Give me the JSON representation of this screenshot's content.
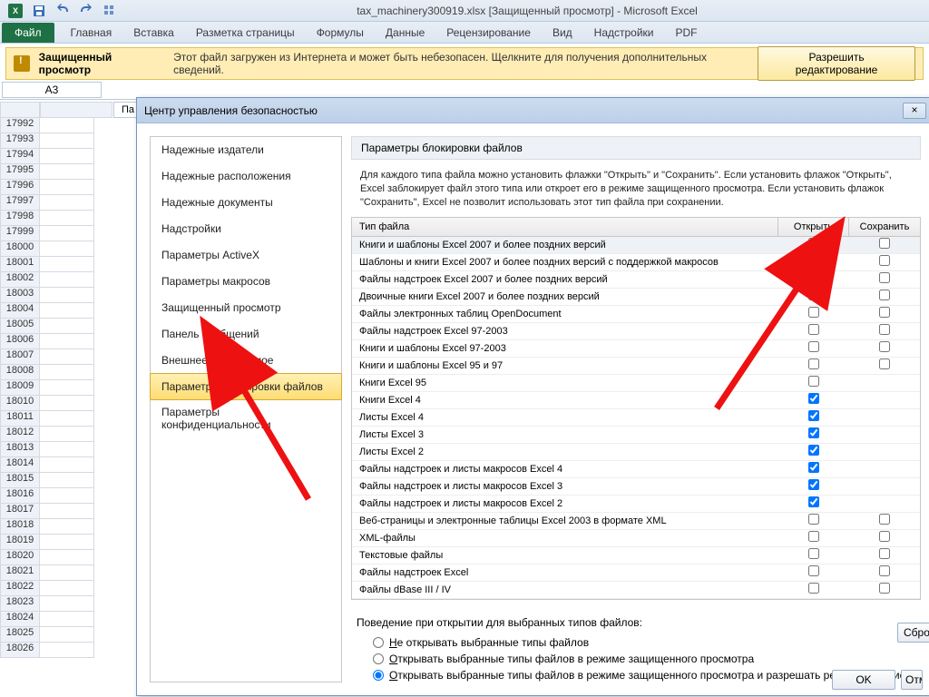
{
  "titlebar": {
    "title": "tax_machinery300919.xlsx  [Защищенный просмотр]  -  Microsoft Excel"
  },
  "ribbon": {
    "file": "Файл",
    "tabs": [
      "Главная",
      "Вставка",
      "Разметка страницы",
      "Формулы",
      "Данные",
      "Рецензирование",
      "Вид",
      "Надстройки",
      "PDF"
    ]
  },
  "protected_view": {
    "label": "Защищенный просмотр",
    "text": "Этот файл загружен из Интернета и может быть небезопасен. Щелкните для получения дополнительных сведений.",
    "button": "Разрешить редактирование"
  },
  "namebox": "A3",
  "partial_header": "Па",
  "row_numbers": [
    17992,
    17993,
    17994,
    17995,
    17996,
    17997,
    17998,
    17999,
    18000,
    18001,
    18002,
    18003,
    18004,
    18005,
    18006,
    18007,
    18008,
    18009,
    18010,
    18011,
    18012,
    18013,
    18014,
    18015,
    18016,
    18017,
    18018,
    18019,
    18020,
    18021,
    18022,
    18023,
    18024,
    18025,
    18026
  ],
  "dialog": {
    "title": "Центр управления безопасностью",
    "close": "×",
    "nav": [
      "Надежные издатели",
      "Надежные расположения",
      "Надежные документы",
      "Надстройки",
      "Параметры ActiveX",
      "Параметры макросов",
      "Защищенный просмотр",
      "Панель сообщений",
      "Внешнее содержимое",
      "Параметры блокировки файлов",
      "Параметры конфиденциальности"
    ],
    "nav_selected": 9,
    "section_title": "Параметры блокировки файлов",
    "intro": "Для каждого типа файла можно установить флажки \"Открыть\" и \"Сохранить\". Если установить флажок \"Открыть\", Excel заблокирует файл этого типа или откроет его в режиме защищенного просмотра. Если установить флажок \"Сохранить\", Excel не позволит использовать этот тип файла при сохранении.",
    "col_type": "Тип файла",
    "col_open": "Открыть",
    "col_save": "Сохранить",
    "rows": [
      {
        "t": "Книги и шаблоны Excel 2007 и более поздних версий",
        "o": false,
        "s": false,
        "hl": true
      },
      {
        "t": "Шаблоны и книги Excel 2007 и более поздних версий с поддержкой макросов",
        "o": false,
        "s": false
      },
      {
        "t": "Файлы надстроек Excel 2007 и более поздних версий",
        "o": false,
        "s": false
      },
      {
        "t": "Двоичные книги Excel 2007 и более поздних версий",
        "o": false,
        "s": false
      },
      {
        "t": "Файлы электронных таблиц OpenDocument",
        "o": false,
        "s": false
      },
      {
        "t": "Файлы надстроек Excel 97-2003",
        "o": false,
        "s": false
      },
      {
        "t": "Книги и шаблоны Excel 97-2003",
        "o": false,
        "s": false
      },
      {
        "t": "Книги и шаблоны Excel 95 и 97",
        "o": false,
        "s": false
      },
      {
        "t": "Книги Excel 95",
        "o": false,
        "s": false,
        "saveHidden": true
      },
      {
        "t": "Книги Excel 4",
        "o": true,
        "s": false,
        "saveHidden": true
      },
      {
        "t": "Листы Excel 4",
        "o": true,
        "s": false,
        "saveHidden": true
      },
      {
        "t": "Листы Excel 3",
        "o": true,
        "s": false,
        "saveHidden": true
      },
      {
        "t": "Листы Excel 2",
        "o": true,
        "s": false,
        "saveHidden": true
      },
      {
        "t": "Файлы надстроек и листы макросов Excel 4",
        "o": true,
        "s": false,
        "saveHidden": true
      },
      {
        "t": "Файлы надстроек и листы макросов Excel 3",
        "o": true,
        "s": false,
        "saveHidden": true
      },
      {
        "t": "Файлы надстроек и листы макросов Excel 2",
        "o": true,
        "s": false,
        "saveHidden": true
      },
      {
        "t": "Веб-страницы и электронные таблицы Excel 2003 в формате XML",
        "o": false,
        "s": false
      },
      {
        "t": "XML-файлы",
        "o": false,
        "s": false
      },
      {
        "t": "Текстовые файлы",
        "o": false,
        "s": false
      },
      {
        "t": "Файлы надстроек Excel",
        "o": false,
        "s": false
      },
      {
        "t": "Файлы dBase III / IV",
        "o": false,
        "s": false
      }
    ],
    "behavior_title": "Поведение при открытии для выбранных типов файлов:",
    "behavior_options": [
      "Не открывать выбранные типы файлов",
      "Открывать выбранные типы файлов в режиме защищенного просмотра",
      "Открывать выбранные типы файлов в режиме защищенного просмотра и разрешать редактирование"
    ],
    "behavior_selected": 2,
    "restore_btn": "Сбросить",
    "ok": "OK",
    "cancel": "Отмена"
  }
}
